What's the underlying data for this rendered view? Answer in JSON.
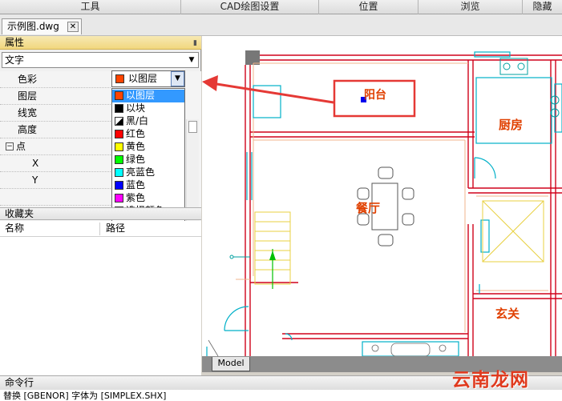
{
  "menubar": {
    "items": [
      "工具",
      "CAD绘图设置",
      "位置",
      "浏览",
      "隐藏"
    ]
  },
  "doc_tab": {
    "title": "示例图.dwg",
    "close": "✕"
  },
  "properties": {
    "title": "属性",
    "object_type": "文字",
    "rows": [
      {
        "label": "色彩"
      },
      {
        "label": "图层"
      },
      {
        "label": "线宽"
      },
      {
        "label": "高度"
      },
      {
        "label": "点"
      },
      {
        "label": "X"
      },
      {
        "label": "Y"
      }
    ],
    "group_toggle": "⊟",
    "color_value": "以图层",
    "color_options": [
      {
        "label": "以图层",
        "color": "#ff4400"
      },
      {
        "label": "以块",
        "color": "#000000"
      },
      {
        "label": "黑/白",
        "color": "#000000"
      },
      {
        "label": "红色",
        "color": "#ff0000"
      },
      {
        "label": "黄色",
        "color": "#ffff00"
      },
      {
        "label": "绿色",
        "color": "#00ff00"
      },
      {
        "label": "亮蓝色",
        "color": "#00ffff"
      },
      {
        "label": "蓝色",
        "color": "#0000ff"
      },
      {
        "label": "紫色",
        "color": "#ff00ff"
      },
      {
        "label": "选择颜色",
        "color": "#ffaa00"
      }
    ]
  },
  "favorites": {
    "title": "收藏夹",
    "col_name": "名称",
    "col_path": "路径"
  },
  "drawing": {
    "labels": {
      "balcony": "阳台",
      "kitchen": "厨房",
      "dining": "餐厅",
      "entry": "玄关"
    },
    "highlight_color": "#e53935",
    "label_color": "#e04000"
  },
  "model_tab": "Model",
  "command": {
    "title": "命令行",
    "last_line": "替换 [GBENOR] 字体为 [SIMPLEX.SHX]"
  },
  "watermark": "云南龙网"
}
